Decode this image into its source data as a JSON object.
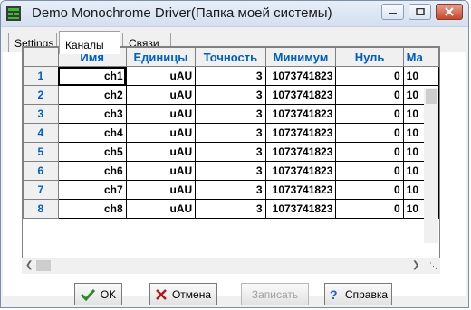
{
  "window": {
    "title": "Demo Monochrome Driver(Папка моей системы)"
  },
  "tabs": [
    {
      "label": "Settings",
      "active": false
    },
    {
      "label": "Каналы",
      "active": true
    },
    {
      "label": "Связи",
      "active": false
    }
  ],
  "grid": {
    "columns": [
      "Имя",
      "Единицы",
      "Точность",
      "Минимум",
      "Нуль",
      "Ма"
    ],
    "rows": [
      {
        "num": "1",
        "cells": [
          "ch1",
          "uAU",
          "3",
          "1073741823",
          "0",
          "10"
        ]
      },
      {
        "num": "2",
        "cells": [
          "ch2",
          "uAU",
          "3",
          "1073741823",
          "0",
          "10"
        ]
      },
      {
        "num": "3",
        "cells": [
          "ch3",
          "uAU",
          "3",
          "1073741823",
          "0",
          "10"
        ]
      },
      {
        "num": "4",
        "cells": [
          "ch4",
          "uAU",
          "3",
          "1073741823",
          "0",
          "10"
        ]
      },
      {
        "num": "5",
        "cells": [
          "ch5",
          "uAU",
          "3",
          "1073741823",
          "0",
          "10"
        ]
      },
      {
        "num": "6",
        "cells": [
          "ch6",
          "uAU",
          "3",
          "1073741823",
          "0",
          "10"
        ]
      },
      {
        "num": "7",
        "cells": [
          "ch7",
          "uAU",
          "3",
          "1073741823",
          "0",
          "10"
        ]
      },
      {
        "num": "8",
        "cells": [
          "ch8",
          "uAU",
          "3",
          "1073741823",
          "0",
          "10"
        ]
      }
    ]
  },
  "buttons": {
    "ok": "OK",
    "cancel": "Отмена",
    "save": "Записать",
    "help": "Справка"
  },
  "colors": {
    "header_text": "#0060c0",
    "ok_check": "#2a8a2a",
    "cancel_x": "#b01818",
    "help_icon": "#2060c0"
  },
  "icons": {
    "ok": "check-icon",
    "cancel": "x-icon",
    "help": "question-icon"
  }
}
